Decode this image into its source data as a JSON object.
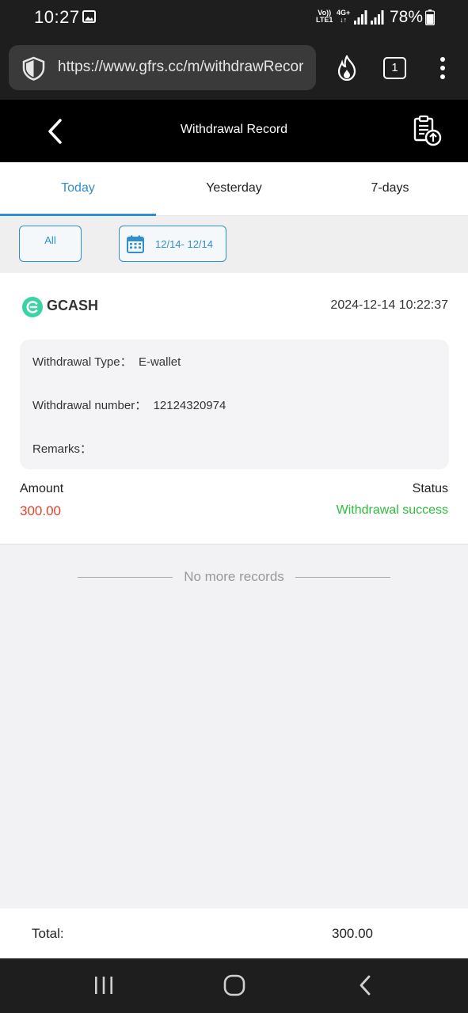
{
  "status_bar": {
    "time": "10:27",
    "volte_top": "Vo))",
    "volte_bottom": "LTE1",
    "network": "4G+",
    "battery": "78%"
  },
  "browser": {
    "url": "https://www.gfrs.cc/m/withdrawRecord",
    "tab_count": "1"
  },
  "header": {
    "title": "Withdrawal Record"
  },
  "tabs": [
    {
      "label": "Today",
      "active": true
    },
    {
      "label": "Yesterday",
      "active": false
    },
    {
      "label": "7-days",
      "active": false
    }
  ],
  "filters": {
    "all_label": "All",
    "date_range": "12/14- 12/14"
  },
  "record": {
    "method": "GCASH",
    "datetime": "2024-12-14 10:22:37",
    "type_label": "Withdrawal Type：",
    "type_value": "E-wallet",
    "number_label": "Withdrawal number：",
    "number_value": "12124320974",
    "remarks_label": "Remarks：",
    "remarks_value": "",
    "amount_label": "Amount",
    "amount_value": "300.00",
    "status_label": "Status",
    "status_value": "Withdrawal success"
  },
  "list_end": "No more records",
  "footer": {
    "total_label": "Total:",
    "total_value": "300.00"
  },
  "colors": {
    "accent": "#2f8fd0",
    "amount": "#e0442d",
    "success": "#2dbd3a",
    "gcash": "#3bd3a6"
  }
}
